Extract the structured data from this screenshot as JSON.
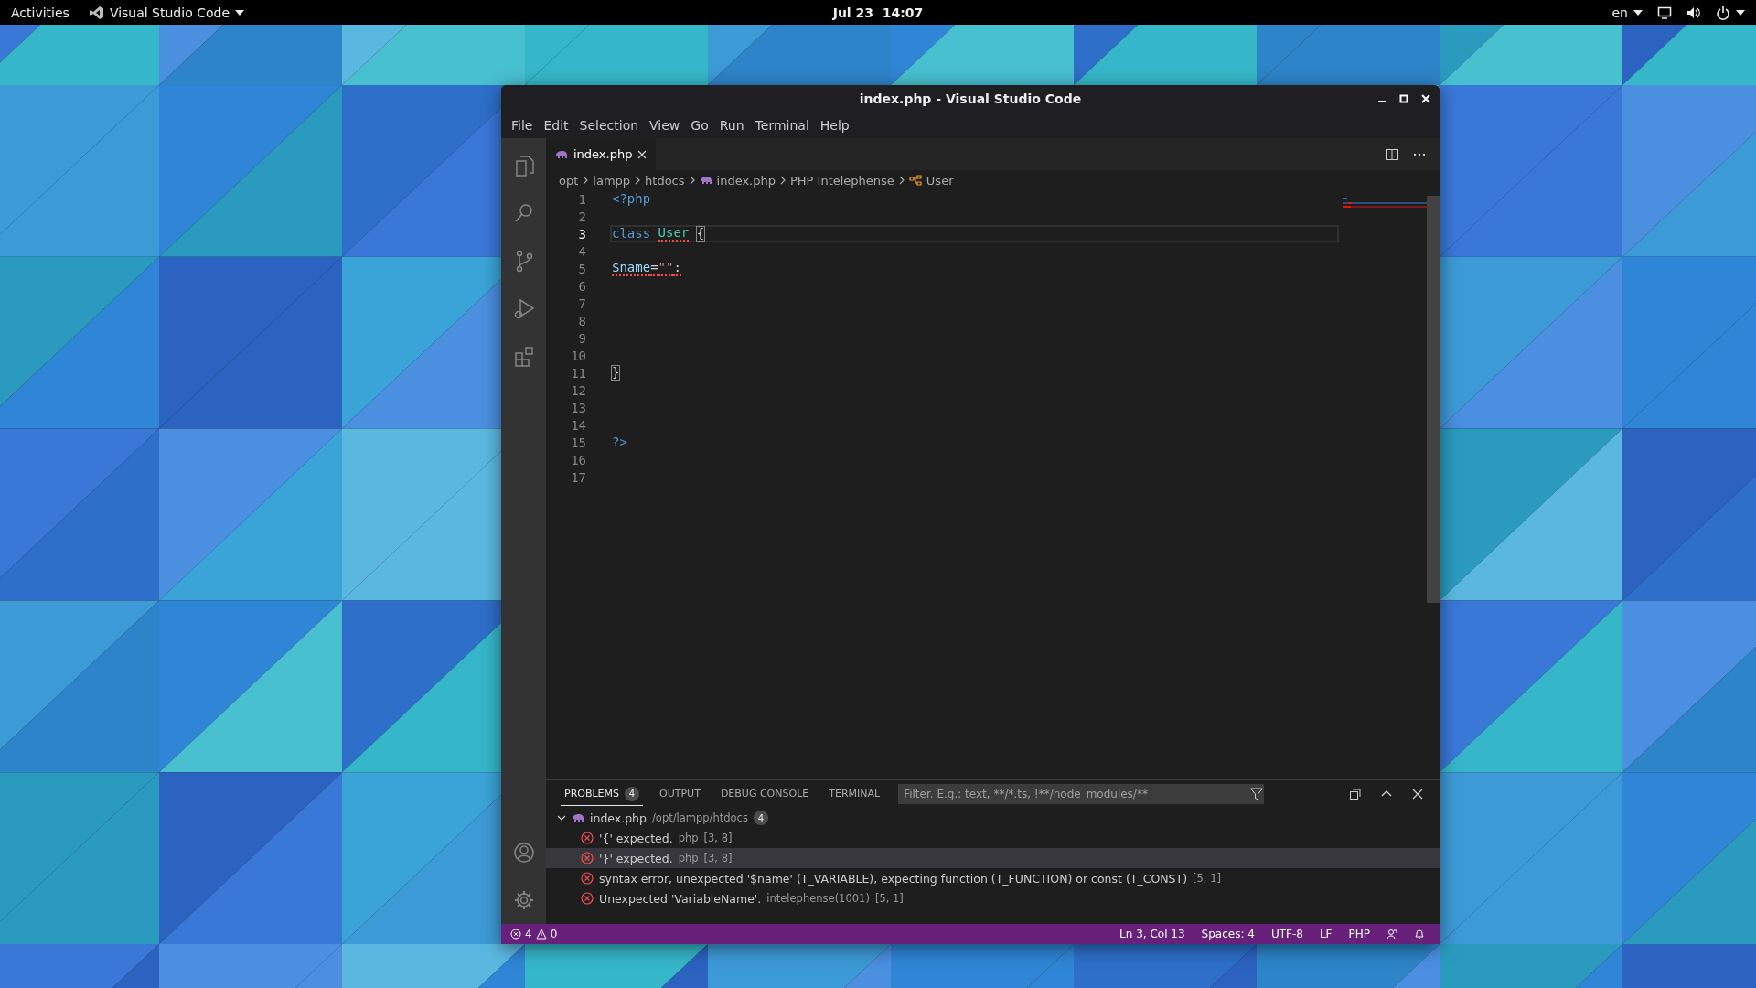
{
  "top_bar": {
    "activities": "Activities",
    "app_menu": "Visual Studio Code",
    "clock": "Jul 23  14:07",
    "keyboard_layout": "en"
  },
  "window": {
    "title": "index.php - Visual Studio Code"
  },
  "menu": [
    "File",
    "Edit",
    "Selection",
    "View",
    "Go",
    "Run",
    "Terminal",
    "Help"
  ],
  "activity_bar": [
    {
      "kind": "files",
      "selected": false
    },
    {
      "kind": "search",
      "selected": false
    },
    {
      "kind": "source-control",
      "selected": false
    },
    {
      "kind": "run-debug",
      "selected": false
    },
    {
      "kind": "extensions",
      "selected": false
    }
  ],
  "editor_tabs": [
    {
      "label": "index.php",
      "selected": true
    }
  ],
  "breadcrumbs": [
    {
      "kind": "folder",
      "text": "opt"
    },
    {
      "kind": "folder",
      "text": "lampp"
    },
    {
      "kind": "folder",
      "text": "htdocs"
    },
    {
      "kind": "php-file",
      "text": "index.php"
    },
    {
      "kind": "folder",
      "text": "PHP Intelephense"
    },
    {
      "kind": "class",
      "text": "User"
    }
  ],
  "code_lines": [
    {
      "number": "1",
      "current": false,
      "tokens": [
        {
          "kind": "tag",
          "text": "<?php"
        }
      ]
    },
    {
      "number": "2",
      "current": false
    },
    {
      "number": "3",
      "current": true,
      "tokens": [
        {
          "kind": "keyword",
          "text": "class"
        },
        {
          "kind": "class",
          "text": "User",
          "space_before": true,
          "squiggle": true
        },
        {
          "kind": "plain",
          "text": "{",
          "space_before": true,
          "matched": true
        }
      ]
    },
    {
      "number": "4",
      "current": false
    },
    {
      "number": "5",
      "current": false,
      "tokens": [
        {
          "kind": "variable",
          "text": "$name",
          "squiggle": true
        },
        {
          "kind": "plain",
          "text": "=",
          "squiggle": true
        },
        {
          "kind": "string",
          "text": "\"\"",
          "squiggle": true
        },
        {
          "kind": "plain",
          "text": ":",
          "squiggle": true
        }
      ]
    },
    {
      "number": "6",
      "current": false
    },
    {
      "number": "7",
      "current": false
    },
    {
      "number": "8",
      "current": false
    },
    {
      "number": "9",
      "current": false
    },
    {
      "number": "10",
      "current": false
    },
    {
      "number": "11",
      "current": false,
      "tokens": [
        {
          "kind": "plain",
          "text": "}",
          "matched": true
        }
      ]
    },
    {
      "number": "12",
      "current": false
    },
    {
      "number": "13",
      "current": false
    },
    {
      "number": "14",
      "current": false
    },
    {
      "number": "15",
      "current": false,
      "tokens": [
        {
          "kind": "tag",
          "text": "?>"
        }
      ]
    },
    {
      "number": "16",
      "current": false
    },
    {
      "number": "17",
      "current": false
    }
  ],
  "panel": {
    "tabs": [
      {
        "label": "PROBLEMS",
        "count": "4",
        "selected": true
      },
      {
        "label": "OUTPUT",
        "selected": false
      },
      {
        "label": "DEBUG CONSOLE",
        "selected": false
      },
      {
        "label": "TERMINAL",
        "selected": false
      }
    ],
    "filter": {
      "placeholder": "Filter. E.g.: text, **/*.ts, !**/node_modules/**"
    },
    "file_group": {
      "name": "index.php",
      "path": "/opt/lampp/htdocs",
      "count": "4",
      "expanded": true
    },
    "problems": [
      {
        "message": "'{' expected.",
        "source": "php",
        "position": "[3, 8]",
        "selected": false
      },
      {
        "message": "'}' expected.",
        "source": "php",
        "position": "[3, 8]",
        "selected": true
      },
      {
        "message": "syntax error, unexpected '$name' (T_VARIABLE), expecting function (T_FUNCTION) or const (T_CONST)",
        "position": "[5, 1]",
        "selected": false
      },
      {
        "message": "Unexpected 'VariableName'.",
        "source": "intelephense(1001)",
        "position": "[5, 1]",
        "selected": false
      }
    ]
  },
  "status_bar": {
    "errors": "4",
    "warnings": "0",
    "items": [
      "Ln 3, Col 13",
      "Spaces: 4",
      "UTF-8",
      "LF",
      "PHP"
    ]
  }
}
